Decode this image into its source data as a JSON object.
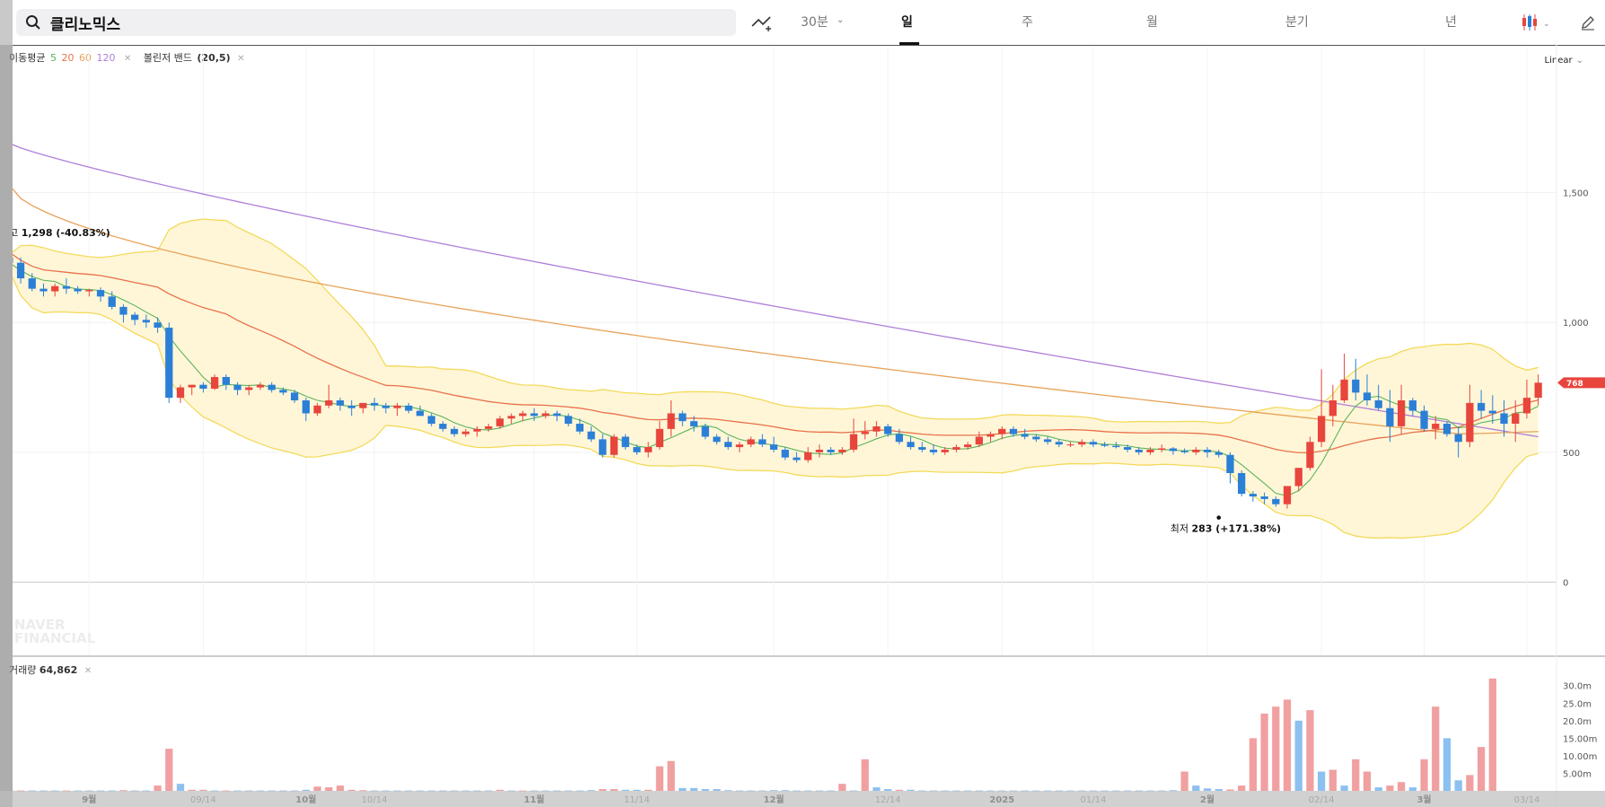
{
  "search": {
    "query": "클리노믹스"
  },
  "toolbar": {
    "tabs": [
      "30분",
      "일",
      "주",
      "월",
      "분기",
      "년"
    ],
    "active_tab": "일"
  },
  "indicators": {
    "ma_label": "이동평균",
    "ma_periods": [
      "5",
      "20",
      "60",
      "120"
    ],
    "ma_colors": [
      "#5ab55a",
      "#e8714a",
      "#e8a35a",
      "#b07ed8"
    ],
    "bb_label": "볼린저 밴드",
    "bb_params": "(20,5)"
  },
  "scale_mode": "Linear",
  "watermark": [
    "NAVER",
    "FINANCIAL"
  ],
  "annotations": {
    "high_label": "최고",
    "high_value": "1,298 (-40.83%)",
    "low_label": "최저",
    "low_value": "283 (+171.38%)"
  },
  "current_price": "768",
  "volume": {
    "label": "거래량",
    "value": "64,862"
  },
  "colors": {
    "up": "#e8453c",
    "down": "#2b7fd6",
    "band": "#fff6d8",
    "band_line": "#f3da5a",
    "vol_up": "#f0a0a0",
    "vol_down": "#8cc0f0"
  },
  "chart_data": {
    "type": "candlestick",
    "price_axis": {
      "ticks": [
        0,
        500,
        1000,
        1500
      ],
      "labels": [
        "0",
        "500",
        "1,000",
        "1,500"
      ],
      "ylim": [
        -230,
        2000
      ]
    },
    "volume_axis": {
      "labels": [
        "5.00m",
        "10.00m",
        "15.00m",
        "20.0m",
        "25.0m",
        "30.0m"
      ],
      "ticks": [
        5,
        10,
        15,
        20,
        25,
        30
      ],
      "ylim": [
        0,
        33
      ]
    },
    "x_labels": [
      "9월",
      "09/14",
      "10월",
      "10/14",
      "11월",
      "11/14",
      "12월",
      "12/14",
      "2025",
      "01/14",
      "2월",
      "02/14",
      "3월",
      "03/14"
    ],
    "x_label_bold": [
      true,
      false,
      true,
      false,
      true,
      false,
      true,
      false,
      true,
      false,
      true,
      false,
      true,
      false
    ],
    "x_label_index": [
      7,
      17,
      26,
      32,
      46,
      55,
      67,
      77,
      87,
      95,
      105,
      115,
      124,
      133
    ],
    "candles": [
      [
        1250,
        1280,
        1200,
        1230
      ],
      [
        1230,
        1250,
        1150,
        1170
      ],
      [
        1170,
        1190,
        1120,
        1130
      ],
      [
        1130,
        1150,
        1100,
        1120
      ],
      [
        1120,
        1150,
        1100,
        1140
      ],
      [
        1140,
        1170,
        1110,
        1130
      ],
      [
        1130,
        1140,
        1110,
        1120
      ],
      [
        1120,
        1130,
        1100,
        1125
      ],
      [
        1125,
        1135,
        1080,
        1100
      ],
      [
        1100,
        1120,
        1050,
        1060
      ],
      [
        1060,
        1070,
        1000,
        1030
      ],
      [
        1030,
        1040,
        990,
        1010
      ],
      [
        1010,
        1030,
        980,
        1000
      ],
      [
        1000,
        1020,
        960,
        980
      ],
      [
        980,
        1000,
        690,
        710
      ],
      [
        710,
        760,
        690,
        750
      ],
      [
        750,
        760,
        720,
        760
      ],
      [
        760,
        770,
        730,
        745
      ],
      [
        745,
        800,
        740,
        790
      ],
      [
        790,
        800,
        740,
        760
      ],
      [
        760,
        770,
        720,
        740
      ],
      [
        740,
        760,
        720,
        750
      ],
      [
        750,
        770,
        740,
        760
      ],
      [
        760,
        770,
        730,
        740
      ],
      [
        740,
        750,
        720,
        730
      ],
      [
        730,
        740,
        690,
        700
      ],
      [
        700,
        710,
        620,
        650
      ],
      [
        650,
        690,
        640,
        680
      ],
      [
        680,
        760,
        670,
        700
      ],
      [
        700,
        710,
        660,
        680
      ],
      [
        680,
        700,
        640,
        670
      ],
      [
        670,
        690,
        650,
        690
      ],
      [
        690,
        710,
        660,
        680
      ],
      [
        680,
        690,
        650,
        670
      ],
      [
        670,
        690,
        640,
        680
      ],
      [
        680,
        690,
        650,
        660
      ],
      [
        660,
        680,
        650,
        640
      ],
      [
        640,
        650,
        600,
        610
      ],
      [
        610,
        620,
        580,
        590
      ],
      [
        590,
        600,
        560,
        570
      ],
      [
        570,
        590,
        560,
        580
      ],
      [
        580,
        600,
        560,
        590
      ],
      [
        590,
        610,
        580,
        600
      ],
      [
        600,
        640,
        590,
        630
      ],
      [
        630,
        650,
        610,
        640
      ],
      [
        640,
        660,
        620,
        650
      ],
      [
        650,
        670,
        620,
        640
      ],
      [
        640,
        660,
        630,
        650
      ],
      [
        650,
        660,
        620,
        640
      ],
      [
        640,
        650,
        600,
        610
      ],
      [
        610,
        630,
        570,
        580
      ],
      [
        580,
        600,
        540,
        550
      ],
      [
        550,
        570,
        480,
        490
      ],
      [
        490,
        570,
        480,
        560
      ],
      [
        560,
        570,
        510,
        520
      ],
      [
        520,
        530,
        490,
        500
      ],
      [
        500,
        540,
        480,
        520
      ],
      [
        520,
        620,
        510,
        590
      ],
      [
        590,
        700,
        560,
        650
      ],
      [
        650,
        660,
        600,
        620
      ],
      [
        620,
        640,
        580,
        600
      ],
      [
        600,
        610,
        550,
        560
      ],
      [
        560,
        570,
        530,
        540
      ],
      [
        540,
        560,
        510,
        520
      ],
      [
        520,
        540,
        500,
        530
      ],
      [
        530,
        560,
        520,
        550
      ],
      [
        550,
        570,
        520,
        530
      ],
      [
        530,
        560,
        500,
        510
      ],
      [
        510,
        520,
        470,
        480
      ],
      [
        480,
        500,
        460,
        470
      ],
      [
        470,
        520,
        460,
        500
      ],
      [
        500,
        530,
        480,
        510
      ],
      [
        510,
        520,
        490,
        500
      ],
      [
        500,
        520,
        490,
        510
      ],
      [
        510,
        630,
        500,
        570
      ],
      [
        570,
        620,
        550,
        580
      ],
      [
        580,
        620,
        560,
        600
      ],
      [
        600,
        610,
        560,
        570
      ],
      [
        570,
        590,
        530,
        540
      ],
      [
        540,
        560,
        510,
        520
      ],
      [
        520,
        540,
        500,
        510
      ],
      [
        510,
        530,
        490,
        500
      ],
      [
        500,
        520,
        490,
        510
      ],
      [
        510,
        530,
        500,
        520
      ],
      [
        520,
        540,
        510,
        530
      ],
      [
        530,
        580,
        520,
        560
      ],
      [
        560,
        580,
        540,
        570
      ],
      [
        570,
        600,
        550,
        590
      ],
      [
        590,
        600,
        560,
        570
      ],
      [
        570,
        590,
        550,
        560
      ],
      [
        560,
        570,
        540,
        550
      ],
      [
        550,
        560,
        530,
        540
      ],
      [
        540,
        550,
        520,
        530
      ],
      [
        530,
        540,
        520,
        530
      ],
      [
        530,
        550,
        520,
        540
      ],
      [
        540,
        550,
        520,
        530
      ],
      [
        530,
        540,
        520,
        525
      ],
      [
        525,
        540,
        515,
        520
      ],
      [
        520,
        530,
        500,
        510
      ],
      [
        510,
        520,
        490,
        500
      ],
      [
        500,
        520,
        490,
        510
      ],
      [
        510,
        530,
        500,
        515
      ],
      [
        515,
        520,
        490,
        505
      ],
      [
        505,
        515,
        495,
        500
      ],
      [
        500,
        520,
        490,
        510
      ],
      [
        510,
        520,
        480,
        500
      ],
      [
        500,
        510,
        480,
        490
      ],
      [
        490,
        500,
        380,
        420
      ],
      [
        420,
        430,
        330,
        340
      ],
      [
        340,
        350,
        310,
        330
      ],
      [
        330,
        345,
        300,
        320
      ],
      [
        320,
        330,
        290,
        300
      ],
      [
        300,
        360,
        283,
        370
      ],
      [
        370,
        440,
        350,
        440
      ],
      [
        440,
        560,
        430,
        540
      ],
      [
        540,
        820,
        520,
        640
      ],
      [
        640,
        760,
        600,
        700
      ],
      [
        700,
        880,
        690,
        780
      ],
      [
        780,
        860,
        700,
        730
      ],
      [
        730,
        800,
        680,
        700
      ],
      [
        700,
        760,
        660,
        670
      ],
      [
        670,
        740,
        540,
        600
      ],
      [
        600,
        760,
        570,
        700
      ],
      [
        700,
        710,
        640,
        660
      ],
      [
        660,
        680,
        580,
        590
      ],
      [
        590,
        640,
        550,
        610
      ],
      [
        610,
        620,
        560,
        570
      ],
      [
        570,
        600,
        480,
        540
      ],
      [
        540,
        760,
        520,
        690
      ],
      [
        690,
        740,
        630,
        660
      ],
      [
        660,
        720,
        610,
        650
      ],
      [
        650,
        700,
        560,
        610
      ],
      [
        610,
        700,
        540,
        650
      ],
      [
        650,
        780,
        630,
        710
      ],
      [
        710,
        800,
        680,
        768
      ]
    ],
    "ma5_visible": true,
    "volumes": [
      [
        0.2,
        1
      ],
      [
        0.1,
        1
      ],
      [
        0.1,
        0
      ],
      [
        0.1,
        0
      ],
      [
        0.1,
        0
      ],
      [
        0.1,
        1
      ],
      [
        0.1,
        0
      ],
      [
        0.1,
        0
      ],
      [
        0.1,
        0
      ],
      [
        0.1,
        0
      ],
      [
        0.2,
        1
      ],
      [
        0.1,
        0
      ],
      [
        0.1,
        0
      ],
      [
        1.5,
        1
      ],
      [
        12,
        1
      ],
      [
        2,
        0
      ],
      [
        0.3,
        1
      ],
      [
        0.3,
        1
      ],
      [
        0.1,
        0
      ],
      [
        0.1,
        1
      ],
      [
        0.1,
        0
      ],
      [
        0.1,
        0
      ],
      [
        0.1,
        0
      ],
      [
        0.1,
        0
      ],
      [
        0.1,
        0
      ],
      [
        0.1,
        0
      ],
      [
        0.3,
        0
      ],
      [
        1.2,
        1
      ],
      [
        1,
        1
      ],
      [
        1.5,
        1
      ],
      [
        0.3,
        1
      ],
      [
        0.2,
        1
      ],
      [
        0.1,
        0
      ],
      [
        0.1,
        0
      ],
      [
        0.1,
        0
      ],
      [
        0.1,
        0
      ],
      [
        0.1,
        0
      ],
      [
        0.1,
        0
      ],
      [
        0.1,
        0
      ],
      [
        0.1,
        0
      ],
      [
        0.1,
        0
      ],
      [
        0.1,
        0
      ],
      [
        0.1,
        0
      ],
      [
        0.3,
        1
      ],
      [
        0.1,
        0
      ],
      [
        0.1,
        1
      ],
      [
        0.1,
        0
      ],
      [
        0.1,
        0
      ],
      [
        0.1,
        0
      ],
      [
        0.1,
        0
      ],
      [
        0.1,
        0
      ],
      [
        0.2,
        0
      ],
      [
        0.5,
        1
      ],
      [
        0.5,
        1
      ],
      [
        0.3,
        0
      ],
      [
        0.3,
        0
      ],
      [
        0.3,
        1
      ],
      [
        7,
        1
      ],
      [
        8.5,
        1
      ],
      [
        0.8,
        0
      ],
      [
        0.8,
        0
      ],
      [
        0.5,
        0
      ],
      [
        0.5,
        0
      ],
      [
        0.2,
        0
      ],
      [
        0.1,
        0
      ],
      [
        0.1,
        0
      ],
      [
        0.1,
        0
      ],
      [
        0.2,
        0
      ],
      [
        0.2,
        0
      ],
      [
        0.1,
        0
      ],
      [
        0.1,
        0
      ],
      [
        0.1,
        0
      ],
      [
        0.1,
        0
      ],
      [
        2,
        1
      ],
      [
        0.1,
        0
      ],
      [
        9,
        1
      ],
      [
        1,
        0
      ],
      [
        0.5,
        0
      ],
      [
        0.3,
        1
      ],
      [
        0.3,
        0
      ],
      [
        0.1,
        0
      ],
      [
        0.1,
        0
      ],
      [
        0.1,
        0
      ],
      [
        0.1,
        0
      ],
      [
        0.1,
        0
      ],
      [
        0.1,
        0
      ],
      [
        0.1,
        0
      ],
      [
        0.1,
        0
      ],
      [
        0.1,
        0
      ],
      [
        0.1,
        0
      ],
      [
        0.1,
        0
      ],
      [
        0.1,
        0
      ],
      [
        0.1,
        0
      ],
      [
        0.1,
        0
      ],
      [
        0.1,
        0
      ],
      [
        0.1,
        0
      ],
      [
        0.1,
        0
      ],
      [
        0.1,
        0
      ],
      [
        0.1,
        0
      ],
      [
        0.1,
        0
      ],
      [
        0.1,
        0
      ],
      [
        0.1,
        0
      ],
      [
        0.2,
        0
      ],
      [
        5.5,
        1
      ],
      [
        1.5,
        0
      ],
      [
        0.7,
        0
      ],
      [
        0.5,
        0
      ],
      [
        0.4,
        1
      ],
      [
        1.5,
        1
      ],
      [
        15,
        1
      ],
      [
        22,
        1
      ],
      [
        24,
        1
      ],
      [
        26,
        1
      ],
      [
        20,
        0
      ],
      [
        23,
        1
      ],
      [
        5.5,
        0
      ],
      [
        6,
        1
      ],
      [
        1.5,
        0
      ],
      [
        9,
        1
      ],
      [
        5.5,
        1
      ],
      [
        1,
        0
      ],
      [
        1.5,
        1
      ],
      [
        2.5,
        1
      ],
      [
        1,
        0
      ],
      [
        9,
        1
      ],
      [
        24,
        1
      ],
      [
        15,
        0
      ],
      [
        3,
        0
      ],
      [
        4.5,
        1
      ],
      [
        12.5,
        1
      ],
      [
        32,
        1
      ]
    ]
  }
}
